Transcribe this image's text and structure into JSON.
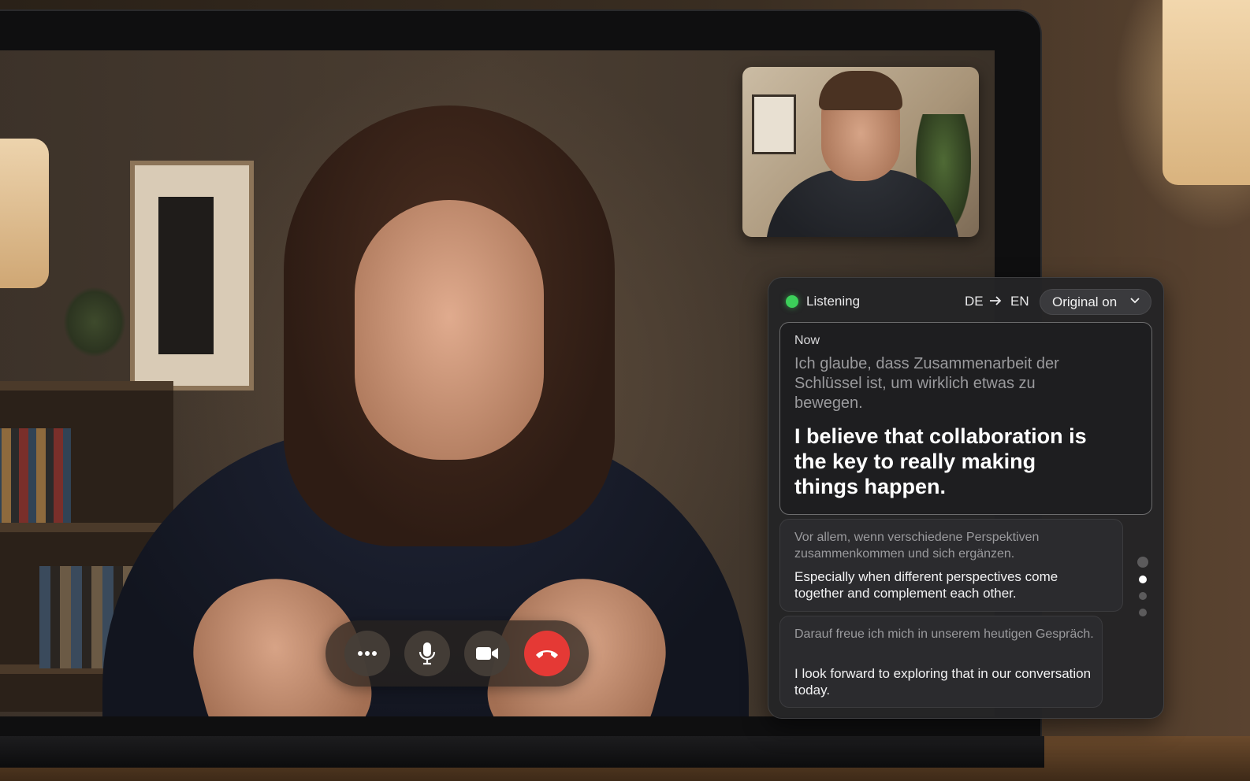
{
  "call": {
    "controls": {
      "more": {
        "icon": "more-horizontal-icon"
      },
      "mic": {
        "icon": "microphone-icon"
      },
      "camera": {
        "icon": "video-camera-icon"
      },
      "end": {
        "icon": "end-call-icon",
        "color": "#e53935"
      }
    }
  },
  "translation_panel": {
    "status": {
      "label": "Listening",
      "color": "#3cd05a"
    },
    "source_lang": "DE",
    "arrow_icon": "arrow-right-icon",
    "target_lang": "EN",
    "mode": {
      "selected": "Original on",
      "icon": "chevron-down-icon"
    },
    "current": {
      "label": "Now",
      "original": "Ich glaube, dass Zusammenarbeit der Schlüssel ist, um wirklich etwas zu bewegen.",
      "translation": "I believe that collaboration is the key to really making things happen."
    },
    "history": [
      {
        "original": "Vor allem, wenn verschiedene Perspektiven zusammenkommen und sich ergänzen.",
        "translation": "Especially when different perspectives come together and complement each other."
      },
      {
        "original": "Darauf freue ich mich in unserem heutigen Gespräch.",
        "translation": "I look forward to exploring that in our conversation today."
      }
    ],
    "pager": {
      "total": 4,
      "active_index": 1
    }
  }
}
